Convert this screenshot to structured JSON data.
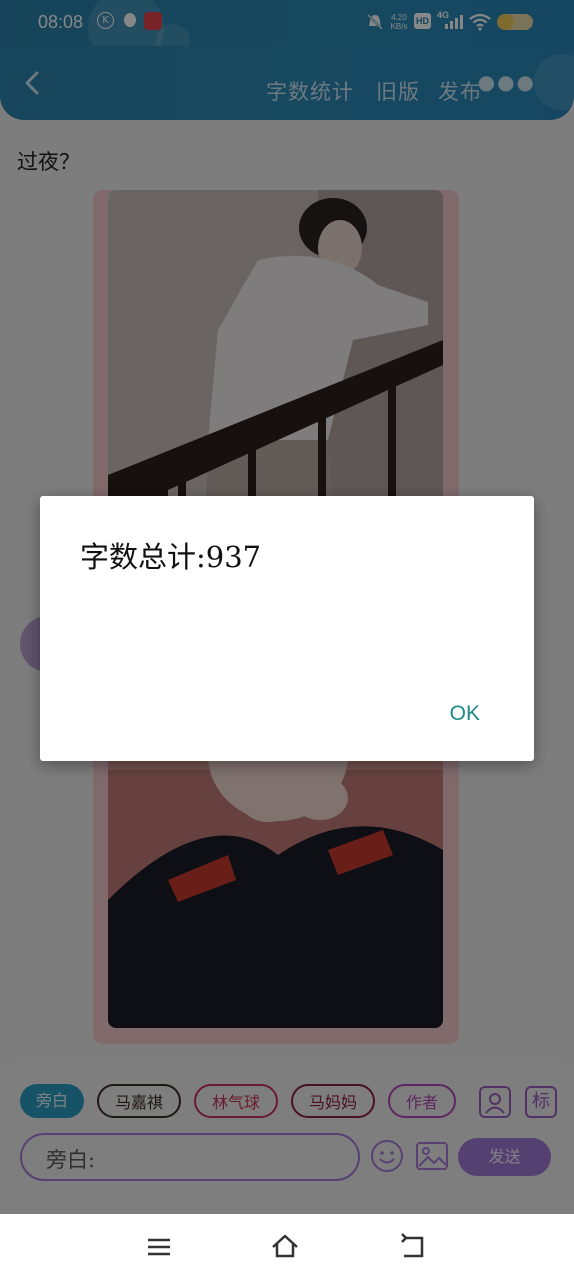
{
  "status_bar": {
    "time": "08:08",
    "left_icons": [
      "k-app-icon",
      "qq-icon",
      "game-icon"
    ],
    "right_icons": [
      "mute-icon",
      "network-speed-icon",
      "hd-icon",
      "signal-4g-icon",
      "wifi-icon",
      "battery-icon"
    ],
    "network_speed_value": "4.20",
    "network_speed_unit": "KB/s",
    "hd_label": "HD",
    "network_label": "4G"
  },
  "app_bar": {
    "back_icon": "chevron-left-icon",
    "word_count_label": "字数统计",
    "old_version_label": "旧版",
    "publish_label": "发布",
    "more_icon": "more-dots-icon"
  },
  "content": {
    "title": "过夜？"
  },
  "dialog": {
    "message": "字数总计:937",
    "ok_label": "OK"
  },
  "composer": {
    "chips": [
      {
        "label": "旁白",
        "selected": true
      },
      {
        "label": "马嘉祺",
        "selected": false
      },
      {
        "label": "林气球",
        "selected": false
      },
      {
        "label": "马妈妈",
        "selected": false
      },
      {
        "label": "作者",
        "selected": false
      }
    ],
    "person_icon": "person-icon",
    "tag_label": "标",
    "input_value": "旁白:",
    "emoji_icon": "emoji-icon",
    "image_icon": "image-icon",
    "send_label": "发送"
  },
  "nav_bar": {
    "menu_icon": "menu-icon",
    "home_icon": "home-icon",
    "back_icon": "back-icon"
  },
  "colors": {
    "accent": "#2b86b3",
    "purple": "#a17ad7",
    "dialog_ok": "#1b8a8a"
  }
}
